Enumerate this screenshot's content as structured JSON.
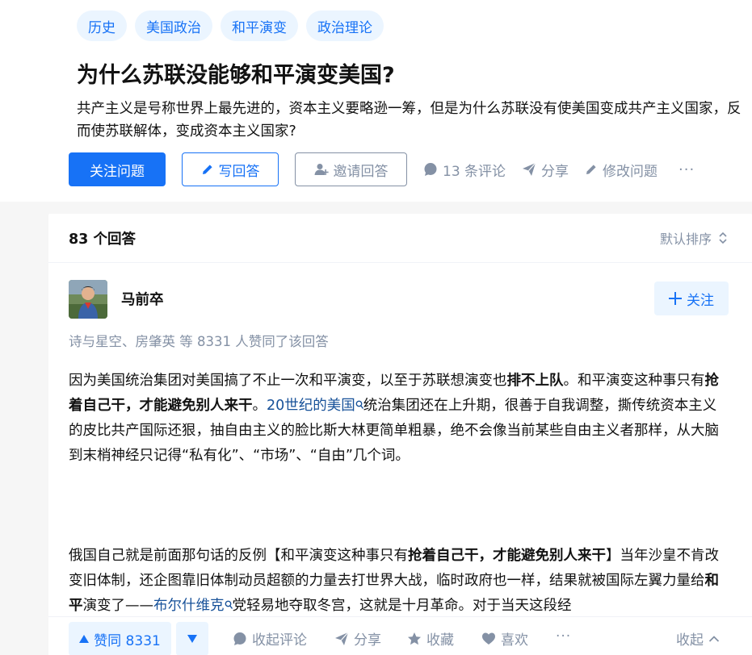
{
  "tags": [
    "历史",
    "美国政治",
    "和平演变",
    "政治理论"
  ],
  "question": {
    "title": "为什么苏联没能够和平演变美国?",
    "description": "共产主义是号称世界上最先进的，资本主义要略逊一筹，但是为什么苏联没有使美国变成共产主义国家，反而使苏联解体，变成资本主义国家?"
  },
  "actions": {
    "follow_label": "关注问题",
    "write_label": "写回答",
    "invite_label": "邀请回答",
    "comments_label": "13 条评论",
    "share_label": "分享",
    "edit_label": "修改问题",
    "more_label": "···"
  },
  "answers": {
    "count_label": "83 个回答",
    "sort_label": "默认排序"
  },
  "answer": {
    "author_name": "马前卒",
    "follow_label": "关注",
    "voters_text": "诗与星空、房肇英 等 8331 人赞同了该回答",
    "p1": {
      "s1": "因为美国统治集团对美国搞了不止一次和平演变，以至于苏联想演变也",
      "b1": "排不上队",
      "s2": "。和平演变这种事只有",
      "b2": "抢着自己干，才能避免别人来干",
      "s3": "。",
      "link": "20世纪的美国",
      "s4": "统治集团还在上升期，很善于自我调整，撕传统资本主义的皮比共产国际还狠，抽自由主义的脸比斯大林更简单粗暴，绝不会像当前某些自由主义者那样，从大脑到末梢神经只记得“私有化”、“市场”、“自由”几个词。"
    },
    "p2": {
      "s1": "俄国自己就是前面那句话的反例【和平演变这种事只有",
      "b1": "抢着自己干，才能避免别人来干",
      "s2": "】当年沙皇不肯改变旧体制，还企图靠旧体制动员超额的力量去打世界大战，临时政府也一样，结果就被国际左翼力量给",
      "b2": "和平",
      "s3": "演变了——",
      "link": "布尔什维克",
      "s4": "党轻易地夺取冬宫，这就是十月革命。对于当天这段经"
    }
  },
  "bottom": {
    "vote_label": "赞同 8331",
    "collapse_comments_label": "收起评论",
    "share_label": "分享",
    "favorite_label": "收藏",
    "like_label": "喜欢",
    "more_label": "···",
    "collapse_label": "收起"
  },
  "colors": {
    "brand": "#1772f6",
    "brand_light": "#ebf5ff",
    "muted": "#8491a5",
    "link": "#175199"
  }
}
